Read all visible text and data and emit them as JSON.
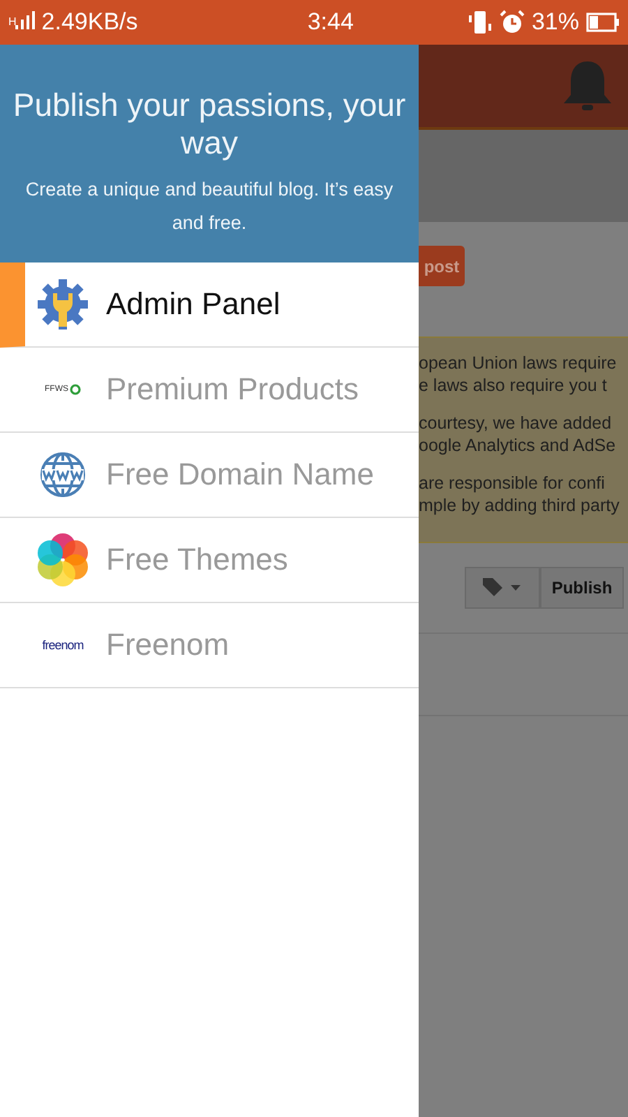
{
  "status_bar": {
    "network": "H",
    "speed": "2.49KB/s",
    "time": "3:44",
    "battery": "31%"
  },
  "drawer": {
    "title": "Publish your passions, your way",
    "subtitle": "Create a unique and beautiful blog. It’s easy and free.",
    "items": [
      {
        "label": "Admin Panel",
        "selected": true,
        "kind": "gear"
      },
      {
        "label": "Premium Products",
        "selected": false,
        "kind": "logo",
        "logo_text": "FFWS"
      },
      {
        "label": "Free Domain Name",
        "selected": false,
        "kind": "globe"
      },
      {
        "label": "Free Themes",
        "selected": false,
        "kind": "petals"
      },
      {
        "label": "Freenom",
        "selected": false,
        "kind": "wordmark",
        "logo_text": "freenom"
      }
    ]
  },
  "background": {
    "post_button": "post",
    "notice": [
      [
        "opean Union laws require",
        "e laws also require you t"
      ],
      [
        "courtesy, we have added",
        "oogle Analytics and AdSe"
      ],
      [
        "are responsible for confi",
        "mple by adding third party"
      ]
    ],
    "publish_button": "Publish"
  }
}
